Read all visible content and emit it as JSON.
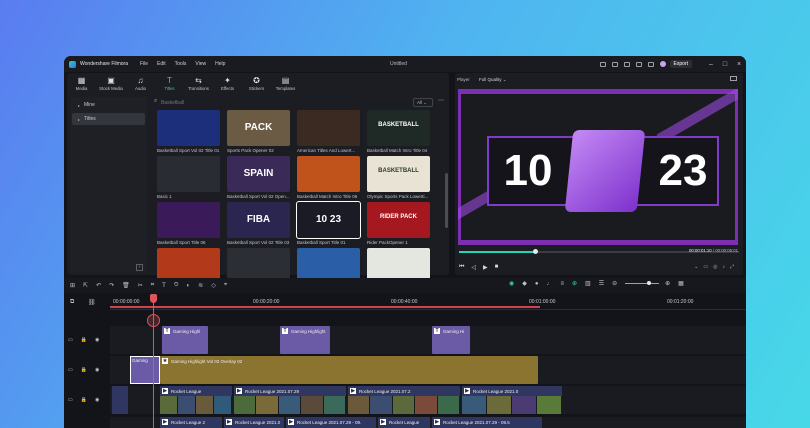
{
  "app": {
    "name": "Wondershare Filmora",
    "doc_title": "Untitled",
    "menu": [
      "File",
      "Edit",
      "Tools",
      "View",
      "Help"
    ],
    "export_label": "Export"
  },
  "toolbar": {
    "items": [
      {
        "icon": "media-icon",
        "glyph": "▦",
        "label": "Media"
      },
      {
        "icon": "stock-media-icon",
        "glyph": "▣",
        "label": "Stock Media"
      },
      {
        "icon": "audio-icon",
        "glyph": "♫",
        "label": "Audio"
      },
      {
        "icon": "titles-icon",
        "glyph": "T",
        "label": "Titles",
        "active": true
      },
      {
        "icon": "transitions-icon",
        "glyph": "⇆",
        "label": "Transitions"
      },
      {
        "icon": "effects-icon",
        "glyph": "✦",
        "label": "Effects"
      },
      {
        "icon": "stickers-icon",
        "glyph": "✪",
        "label": "Stickers"
      },
      {
        "icon": "templates-icon",
        "glyph": "▤",
        "label": "Templates"
      }
    ]
  },
  "sidebar": {
    "items": [
      {
        "label": "Mine",
        "selected": false
      },
      {
        "label": "Titles",
        "selected": true
      }
    ]
  },
  "search": {
    "placeholder": "Basketball",
    "filter": "All"
  },
  "tiles": [
    {
      "name": "Basketball Sport Vol 02 Title 01",
      "bg": "#1c2f7a",
      "cap": ""
    },
    {
      "name": "Sports Pack Opener 02",
      "bg": "#6b5a44",
      "cap": "PACK"
    },
    {
      "name": "American Titles And Lowert...",
      "bg": "#3a2a22",
      "cap": ""
    },
    {
      "name": "Basketball Match Intro Title 04",
      "bg": "#1f2a26",
      "cap": "BASKETBALL"
    },
    {
      "name": "Basic 1",
      "bg": "#2a2c33",
      "cap": ""
    },
    {
      "name": "Basketball Sport Vol 02 Open...",
      "bg": "#3a2a58",
      "cap": "SPAIN"
    },
    {
      "name": "Basketball Match Intro Title 06",
      "bg": "#c0521c",
      "cap": ""
    },
    {
      "name": "Olympic Sports Pack Lowerti...",
      "bg": "#e9e3d6",
      "cap": "BASKETBALL"
    },
    {
      "name": "Basketball Sport Title 06",
      "bg": "#3a1a58",
      "cap": ""
    },
    {
      "name": "Basketball Sport Vol 02 Title 03",
      "bg": "#2b2650",
      "cap": "FIBA"
    },
    {
      "name": "Basketball Sport Title 01",
      "bg": "#1a1b24",
      "cap": "10 23"
    },
    {
      "name": "Rider PackOpener 1",
      "bg": "#a51820",
      "cap": "RIDER PACK"
    },
    {
      "name": "",
      "bg": "#b23a1a",
      "cap": ""
    },
    {
      "name": "",
      "bg": "#2c2e36",
      "cap": ""
    },
    {
      "name": "",
      "bg": "#2a5fa8",
      "cap": ""
    },
    {
      "name": "",
      "bg": "#e4e6e0",
      "cap": ""
    }
  ],
  "player": {
    "label": "Player",
    "quality": "Full Quality",
    "score_left": "10",
    "score_right": "23",
    "current_time": "00:00:01:10",
    "total_time": "00:00:05:01",
    "progress": 0.27
  },
  "timeline": {
    "ruler": [
      "00:00:00:00",
      "00:00:20:00",
      "00:00:40:00",
      "00:01:00:00",
      "00:01:20:00"
    ],
    "title_clips": [
      "Gaming Highl",
      "Gaming Highlight",
      "Gaming Hi"
    ],
    "overlay_clip": "Gaming Highlight Vol 03 Overlay 02",
    "selected_clip": "Gaming",
    "video_clips": [
      "Rocket League",
      "Rocket League 2021.07.29",
      "Rocket League 2021.07.2",
      "Rocket League 2021.0"
    ],
    "bottom_clips": [
      "Rocket League 2",
      "Rocket League 2021.0",
      "Rocket League 2021.07.29 - 09.",
      "Rocket League",
      "Rocket League 2021.07.29 - 09.5"
    ]
  },
  "colors": {
    "accent": "#27d3b6",
    "playhead": "#e0545e",
    "title_clip": "#6b5ba6",
    "overlay_clip": "#8b7430"
  }
}
